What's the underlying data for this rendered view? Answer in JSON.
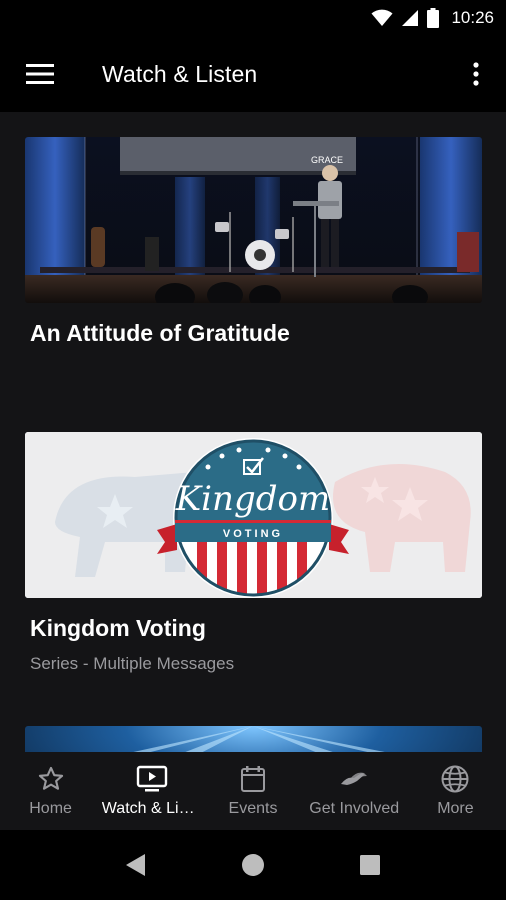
{
  "status_bar": {
    "time": "10:26",
    "icons": [
      "wifi-icon",
      "cellular-signal-icon",
      "battery-icon"
    ]
  },
  "app_bar": {
    "title": "Watch & Listen",
    "menu_icon": "hamburger-menu-icon",
    "overflow_icon": "more-vert-icon"
  },
  "cards": [
    {
      "title": "An Attitude of Gratitude",
      "subtitle": "",
      "image": "stage-speaker-photo",
      "image_text": "GRACE"
    },
    {
      "title": "Kingdom Voting",
      "subtitle": "Series - Multiple Messages",
      "image": "kingdom-voting-banner",
      "logo_word": "Kingdom",
      "logo_ribbon": "VOTING"
    },
    {
      "title": "",
      "subtitle": "",
      "image": "stage-lights-photo"
    }
  ],
  "bottom_nav": {
    "items": [
      {
        "label": "Home",
        "icon": "star-icon",
        "active": false
      },
      {
        "label": "Watch & Lis…",
        "icon": "tv-play-icon",
        "active": true
      },
      {
        "label": "Events",
        "icon": "calendar-icon",
        "active": false
      },
      {
        "label": "Get Involved",
        "icon": "hands-icon",
        "active": false
      },
      {
        "label": "More",
        "icon": "globe-icon",
        "active": false
      }
    ]
  },
  "system_nav": {
    "icons": [
      "back-icon",
      "home-circle-icon",
      "recents-square-icon"
    ]
  },
  "colors": {
    "background": "#141416",
    "bar": "#000000",
    "text_primary": "#ffffff",
    "text_secondary": "#9a9a9e",
    "accent_red": "#d42a35",
    "accent_teal": "#2b6c87"
  }
}
